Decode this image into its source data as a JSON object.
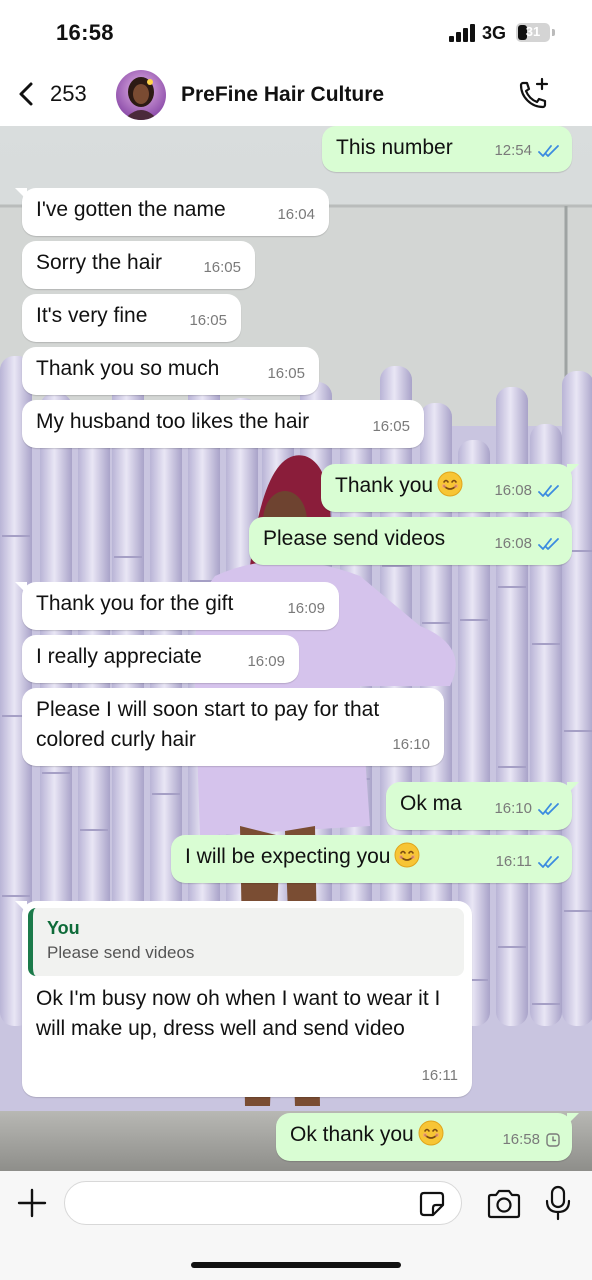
{
  "status_bar": {
    "time": "16:58",
    "network": "3G",
    "battery": "31",
    "battery_level_percent": 31
  },
  "header": {
    "back_count": "253",
    "contact_name": "PreFine Hair Culture",
    "icons": {
      "back": "chevron-left-icon",
      "call": "phone-add-icon"
    }
  },
  "messages": [
    {
      "direction": "out",
      "text": "This number",
      "time": "12:54",
      "status": "read"
    },
    {
      "direction": "in",
      "text": "I've gotten the name",
      "time": "16:04"
    },
    {
      "direction": "in",
      "text": "Sorry the hair",
      "time": "16:05"
    },
    {
      "direction": "in",
      "text": "It's very fine",
      "time": "16:05"
    },
    {
      "direction": "in",
      "text": "Thank you so much",
      "time": "16:05"
    },
    {
      "direction": "in",
      "text": "My husband too likes the hair",
      "time": "16:05"
    },
    {
      "direction": "out",
      "text": "Thank you",
      "emoji": "smiling-face",
      "time": "16:08",
      "status": "read"
    },
    {
      "direction": "out",
      "text": "Please send videos",
      "time": "16:08",
      "status": "read"
    },
    {
      "direction": "in",
      "text": "Thank you for the gift",
      "time": "16:09"
    },
    {
      "direction": "in",
      "text": "I really appreciate",
      "time": "16:09"
    },
    {
      "direction": "in",
      "text": "Please I will soon start to pay for that colored curly hair",
      "time": "16:10"
    },
    {
      "direction": "out",
      "text": "Ok ma",
      "time": "16:10",
      "status": "read"
    },
    {
      "direction": "out",
      "text": "I will be expecting you",
      "emoji": "smiling-face",
      "time": "16:11",
      "status": "read"
    },
    {
      "direction": "in",
      "quote_author": "You",
      "quote_text": "Please send videos",
      "text": "Ok I'm busy now oh when I want to wear it I will make up, dress well and send video",
      "time": "16:11"
    },
    {
      "direction": "out",
      "text": "Ok thank you",
      "emoji": "smiling-face",
      "time": "16:58",
      "status": "pending"
    }
  ],
  "footer": {
    "input_value": "",
    "icons": [
      "plus-icon",
      "sticker-icon",
      "camera-icon",
      "microphone-icon"
    ]
  },
  "colors": {
    "outgoing_bubble": "#d9fdd3",
    "incoming_bubble": "#ffffff",
    "read_ticks": "#3b8be0",
    "quote_accent": "#1b7a4a"
  }
}
